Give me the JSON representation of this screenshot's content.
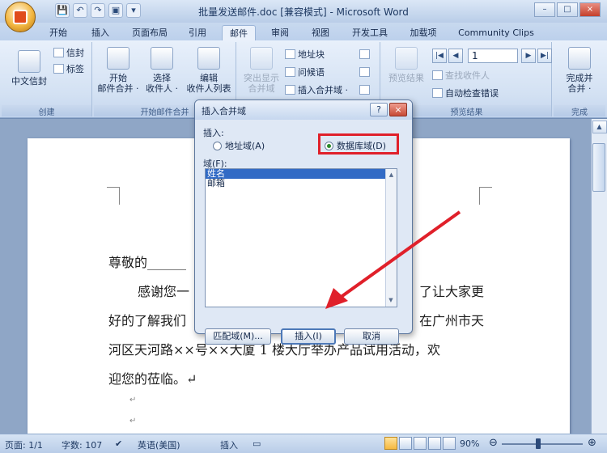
{
  "window": {
    "title": "批量发送邮件.doc [兼容模式] - Microsoft Word",
    "controls": [
      "–",
      "□",
      "×"
    ]
  },
  "quick_access": [
    "💾",
    "↶",
    "↷",
    "▣",
    "▾"
  ],
  "tabs": [
    "开始",
    "插入",
    "页面布局",
    "引用",
    "邮件",
    "审阅",
    "视图",
    "开发工具",
    "加载项",
    "Community Clips"
  ],
  "active_tab": "邮件",
  "ribbon": {
    "groups": {
      "create": "创建",
      "start_merge": "开始邮件合并",
      "preview": "预览结果",
      "finish": "完成"
    },
    "buttons": {
      "chinese_envelope": "中文信封",
      "envelope": "信封",
      "label": "标签",
      "start_merge_l1": "开始",
      "start_merge_l2": "邮件合并 ·",
      "select_l1": "选择",
      "select_l2": "收件人 ·",
      "edit_l1": "编辑",
      "edit_l2": "收件人列表",
      "highlight_l1": "突出显示",
      "highlight_l2": "合并域",
      "address_block": "地址块",
      "greeting_line": "问候语",
      "insert_merge_field": "插入合并域 ·",
      "preview_results": "预览结果",
      "find_recipient": "查找收件人",
      "auto_check": "自动检查错误",
      "finish_l1": "完成并",
      "finish_l2": "合并 ·"
    },
    "record_number": "1"
  },
  "document": {
    "greeting": "尊敬的______",
    "line1_left": "感谢您一",
    "line1_right": "了让大家更",
    "line2_left": "好的了解我们",
    "line2_right": "在广州市天",
    "line3": "河区天河路××号××大厦 1 楼大厅举办产品试用活动，欢",
    "line4": "迎您的莅临。↵",
    "para_mark_1": "↵",
    "para_mark_2": "↵"
  },
  "dialog": {
    "title": "插入合并域",
    "help": "?",
    "close": "×",
    "insert_label": "插入:",
    "radio_address": "地址域(A)",
    "radio_database": "数据库域(D)",
    "fields_label": "域(F):",
    "fields": [
      "姓名",
      "邮箱"
    ],
    "selected_field": "姓名",
    "match_fields": "匹配域(M)...",
    "insert_button": "插入(I)",
    "cancel_button": "取消"
  },
  "statusbar": {
    "page": "页面: 1/1",
    "words": "字数: 107",
    "language": "英语(美国)",
    "mode": "插入",
    "zoom": "90%",
    "zoom_fraction": 0.45
  },
  "colors": {
    "highlight_box": "#e0202a",
    "arrow": "#e0202a",
    "selection": "#316ac5"
  }
}
